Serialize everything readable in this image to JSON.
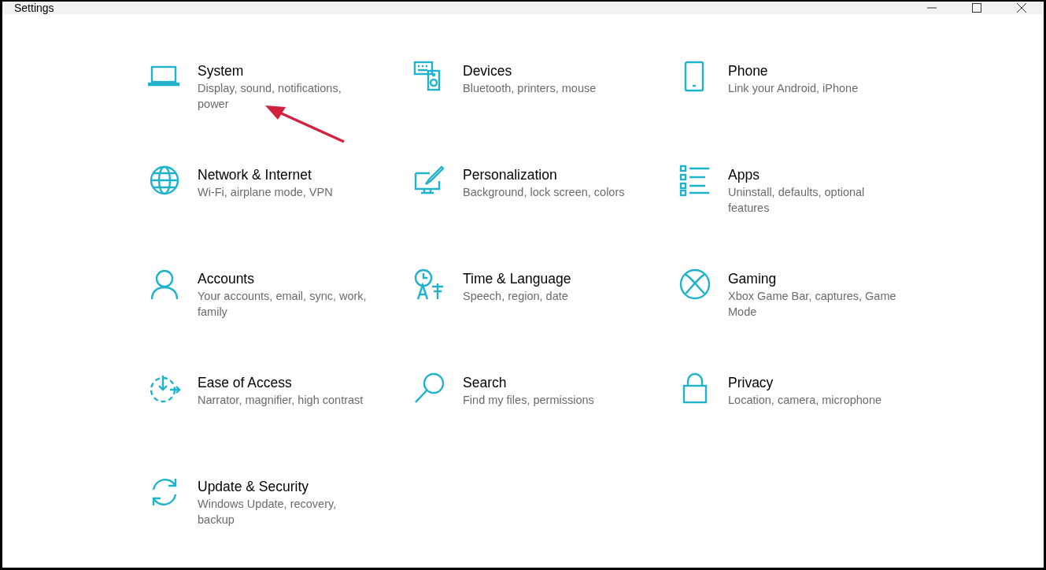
{
  "window": {
    "title": "Settings"
  },
  "categories": [
    {
      "title": "System",
      "description": "Display, sound, notifications, power"
    },
    {
      "title": "Devices",
      "description": "Bluetooth, printers, mouse"
    },
    {
      "title": "Phone",
      "description": "Link your Android, iPhone"
    },
    {
      "title": "Network & Internet",
      "description": "Wi-Fi, airplane mode, VPN"
    },
    {
      "title": "Personalization",
      "description": "Background, lock screen, colors"
    },
    {
      "title": "Apps",
      "description": "Uninstall, defaults, optional features"
    },
    {
      "title": "Accounts",
      "description": "Your accounts, email, sync, work, family"
    },
    {
      "title": "Time & Language",
      "description": "Speech, region, date"
    },
    {
      "title": "Gaming",
      "description": "Xbox Game Bar, captures, Game Mode"
    },
    {
      "title": "Ease of Access",
      "description": "Narrator, magnifier, high contrast"
    },
    {
      "title": "Search",
      "description": "Find my files, permissions"
    },
    {
      "title": "Privacy",
      "description": "Location, camera, microphone"
    },
    {
      "title": "Update & Security",
      "description": "Windows Update, recovery, backup"
    }
  ]
}
